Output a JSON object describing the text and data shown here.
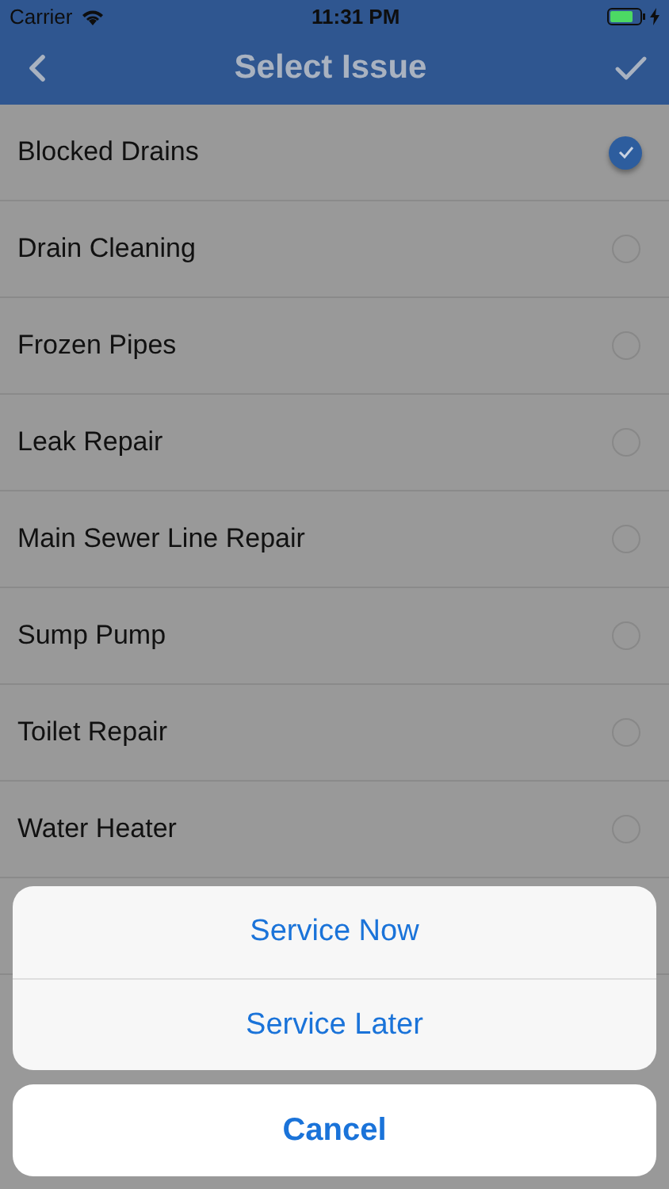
{
  "status_bar": {
    "carrier": "Carrier",
    "time": "11:31 PM"
  },
  "nav": {
    "title": "Select Issue"
  },
  "issues": [
    {
      "label": "Blocked Drains",
      "selected": true
    },
    {
      "label": "Drain Cleaning",
      "selected": false
    },
    {
      "label": "Frozen Pipes",
      "selected": false
    },
    {
      "label": "Leak Repair",
      "selected": false
    },
    {
      "label": "Main Sewer Line Repair",
      "selected": false
    },
    {
      "label": "Sump Pump",
      "selected": false
    },
    {
      "label": "Toilet Repair",
      "selected": false
    },
    {
      "label": "Water Heater",
      "selected": false
    }
  ],
  "action_sheet": {
    "actions": [
      {
        "label": "Service Now"
      },
      {
        "label": "Service Later"
      }
    ],
    "cancel": "Cancel"
  }
}
